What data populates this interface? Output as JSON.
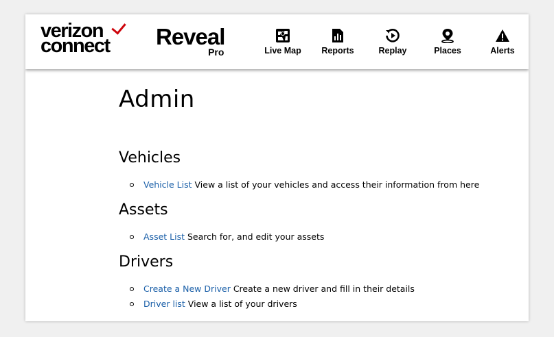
{
  "brand": {
    "company_line1": "verizon",
    "company_line2": "connect",
    "product": "Reveal",
    "product_tier": "Pro",
    "accent_color": "#cd040b"
  },
  "nav": [
    {
      "label": "Live Map",
      "icon": "map-icon"
    },
    {
      "label": "Reports",
      "icon": "bar-chart-icon"
    },
    {
      "label": "Replay",
      "icon": "replay-icon"
    },
    {
      "label": "Places",
      "icon": "location-pin-icon"
    },
    {
      "label": "Alerts",
      "icon": "warning-icon"
    }
  ],
  "page": {
    "title": "Admin",
    "sections": [
      {
        "title": "Vehicles",
        "items": [
          {
            "link": "Vehicle List",
            "desc": "View a list of your vehicles and access their information from here"
          }
        ]
      },
      {
        "title": "Assets",
        "items": [
          {
            "link": "Asset List",
            "desc": "Search for, and edit your assets"
          }
        ]
      },
      {
        "title": "Drivers",
        "items": [
          {
            "link": "Create a New Driver",
            "desc": "Create a new driver and fill in their details"
          },
          {
            "link": "Driver list",
            "desc": "View a list of your drivers"
          }
        ]
      }
    ]
  },
  "colors": {
    "link": "#1a5fa8",
    "background": "#f0f0f0"
  }
}
